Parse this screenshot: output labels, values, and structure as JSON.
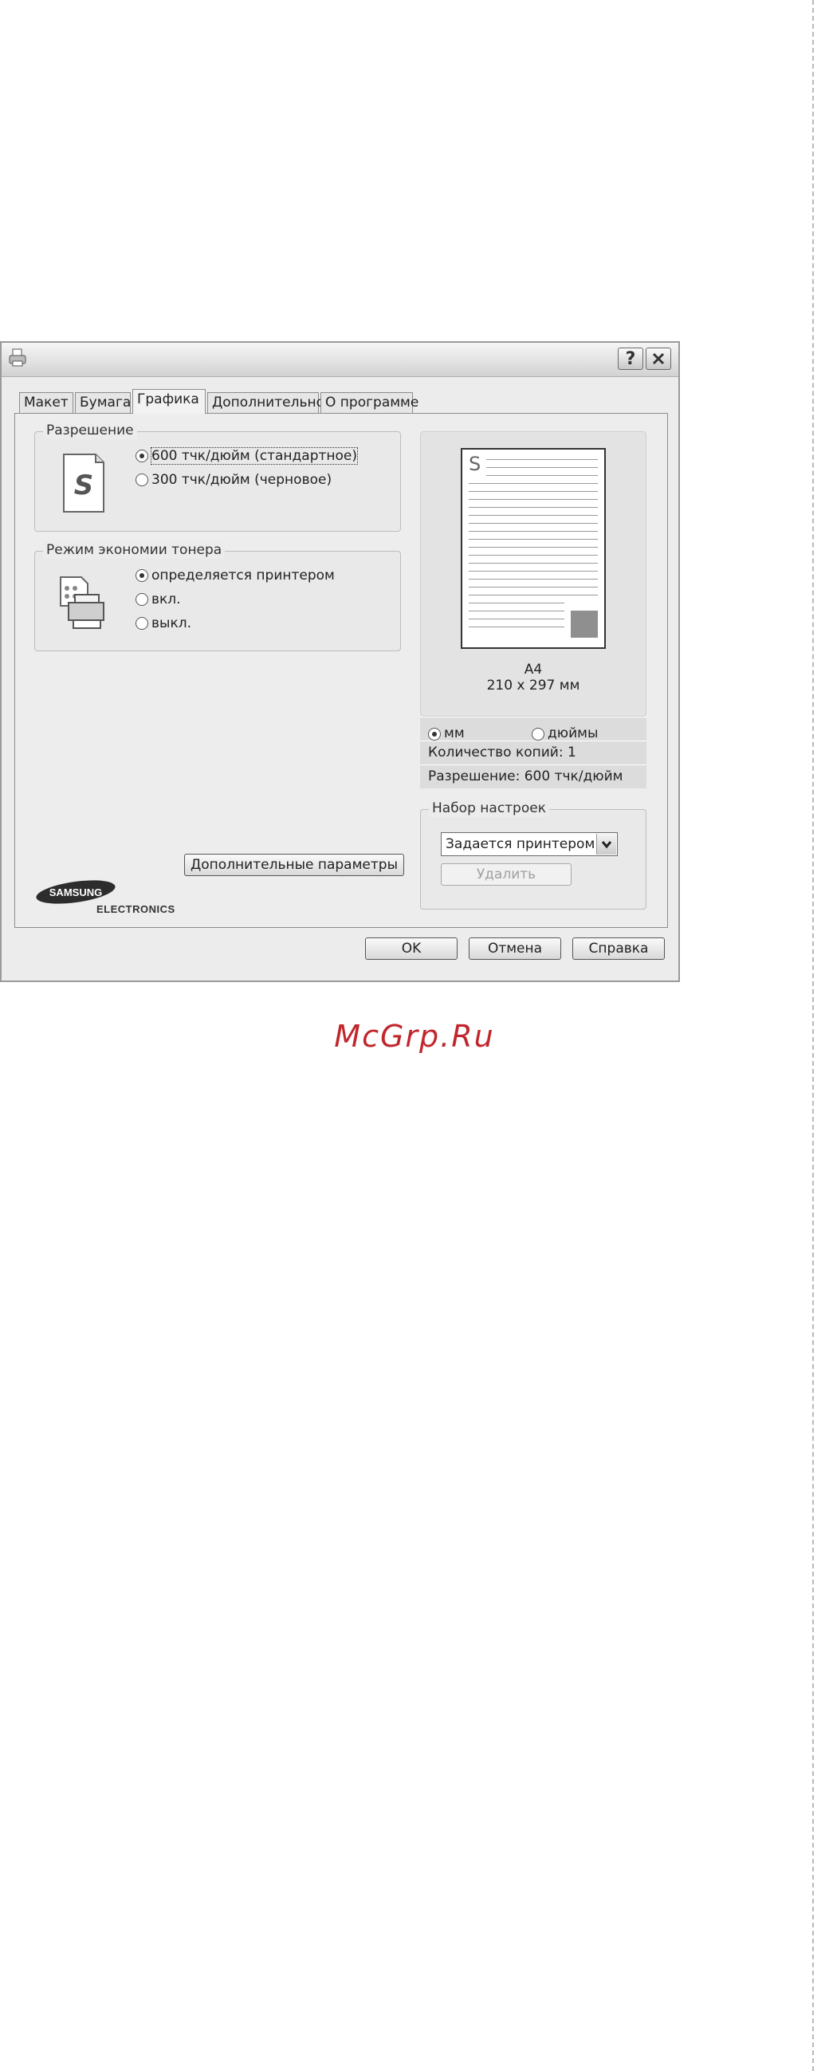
{
  "tabs": [
    "Макет",
    "Бумага",
    "Графика",
    "Дополнительно",
    "О программе"
  ],
  "active_tab": "Графика",
  "resolution_group": {
    "title": "Разрешение",
    "options": [
      "600 тчк/дюйм (стандартное)",
      "300 тчк/дюйм (черновое)"
    ],
    "selected": "600 тчк/дюйм (стандартное)"
  },
  "toner_group": {
    "title": "Режим экономии тонера",
    "options": [
      "определяется принтером",
      "вкл.",
      "выкл."
    ],
    "selected": "определяется принтером"
  },
  "advanced_button": "Дополнительные параметры",
  "brand": {
    "logo_top": "SAMSUNG",
    "logo_bottom": "ELECTRONICS"
  },
  "preview": {
    "paper_name": "A4",
    "paper_size": "210 x 297 мм",
    "page_letter": "S",
    "units": {
      "mm_label": "мм",
      "inch_label": "дюймы",
      "selected": "мм"
    },
    "copies": "Количество копий: 1",
    "resolution": "Разрешение: 600 тчк/дюйм"
  },
  "favorites": {
    "title": "Набор настроек",
    "selected_value": "Задается принтером",
    "delete_button": "Удалить"
  },
  "footer_buttons": {
    "ok": "OK",
    "cancel": "Отмена",
    "help": "Справка"
  },
  "title_buttons": {
    "help": "?"
  },
  "watermark_text": "McGrp.Ru",
  "icons": [
    "printer-app-icon",
    "help-icon",
    "close-icon",
    "document-s-icon",
    "toner-printer-icon",
    "chevron-down-icon"
  ],
  "colors": {
    "watermark": "#c0272d",
    "dialog_bg": "#ececec",
    "preview_square": "#8f8f8f"
  }
}
